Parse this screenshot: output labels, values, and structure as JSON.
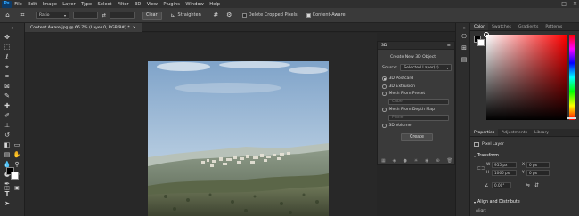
{
  "app": {
    "logo": "Ps"
  },
  "menu": [
    "File",
    "Edit",
    "Image",
    "Layer",
    "Type",
    "Select",
    "Filter",
    "3D",
    "View",
    "Plugins",
    "Window",
    "Help"
  ],
  "window_controls": {
    "minimize": "–",
    "maximize": "□",
    "close": "✕"
  },
  "options_bar": {
    "ratio_value": "Ratio",
    "clear_label": "Clear",
    "straighten_label": "Straighten",
    "delete_cropped_label": "Delete Cropped Pixels",
    "delete_cropped_checked": false,
    "content_aware_label": "Content-Aware",
    "content_aware_checked": true
  },
  "document_tab": {
    "title": "Content Aware.jpg @ 66.7% (Layer 0, RGB/8#) *",
    "close": "×"
  },
  "panel_3d": {
    "title": "3D",
    "create_new_label": "Create New 3D Object",
    "source_label": "Source:",
    "source_value": "Selected Layer(s)",
    "options": [
      {
        "label": "3D Postcard",
        "selected": true
      },
      {
        "label": "3D Extrusion",
        "selected": false
      },
      {
        "label": "Mesh From Preset",
        "selected": false
      },
      {
        "label": "Mesh From Depth Map",
        "selected": false
      },
      {
        "label": "3D Volume",
        "selected": false
      }
    ],
    "preset_value": "Cube",
    "depth_value": "Plane",
    "create_button": "Create"
  },
  "color_panel": {
    "tabs": [
      "Color",
      "Swatches",
      "Gradients",
      "Patterns"
    ],
    "active_tab": "Color"
  },
  "properties_panel": {
    "tabs": [
      "Properties",
      "Adjustments",
      "Library"
    ],
    "active_tab": "Properties",
    "layer_type": "Pixel Layer",
    "transform_label": "Transform",
    "w_label": "W",
    "w_value": "955 px",
    "h_label": "H",
    "h_value": "1066 px",
    "x_value": "0 px",
    "y_value": "0 px",
    "angle_value": "0.00°",
    "align_label": "Align and Distribute",
    "align_sub": "Align:"
  },
  "colors": {
    "accent": "#31a8ff",
    "foreground": "#000000",
    "background": "#ffffff",
    "picker_hue": "#ff0000"
  }
}
